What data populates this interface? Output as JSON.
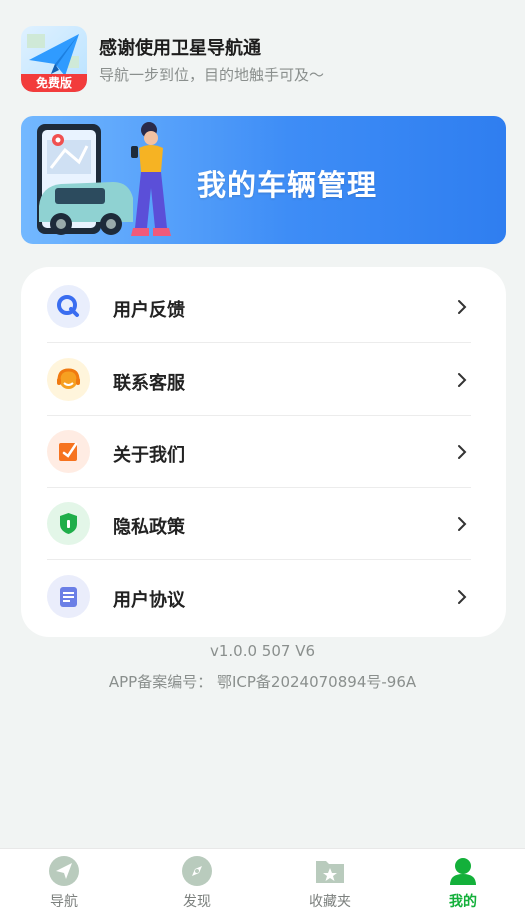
{
  "header": {
    "logo_badge": "免费版",
    "title": "感谢使用卫星导航通",
    "subtitle": "导航一步到位，目的地触手可及～"
  },
  "banner": {
    "text": "我的车辆管理"
  },
  "menu": {
    "items": [
      {
        "label": "用户反馈",
        "icon": "feedback-icon"
      },
      {
        "label": "联系客服",
        "icon": "customer-service-icon"
      },
      {
        "label": "关于我们",
        "icon": "about-icon"
      },
      {
        "label": "隐私政策",
        "icon": "privacy-shield-icon"
      },
      {
        "label": "用户协议",
        "icon": "agreement-document-icon"
      }
    ]
  },
  "footer": {
    "version": "v1.0.0 507 V6",
    "icp": "APP备案编号： 鄂ICP备2024070894号-96A"
  },
  "tabs": [
    {
      "label": "导航",
      "icon": "navigation-icon",
      "active": false
    },
    {
      "label": "发现",
      "icon": "compass-icon",
      "active": false
    },
    {
      "label": "收藏夹",
      "icon": "favorites-folder-icon",
      "active": false
    },
    {
      "label": "我的",
      "icon": "profile-icon",
      "active": true
    }
  ],
  "colors": {
    "accent": "#13b03a",
    "banner_start": "#73b8ff",
    "banner_end": "#2f7ef0",
    "background": "#f1f4f3"
  }
}
